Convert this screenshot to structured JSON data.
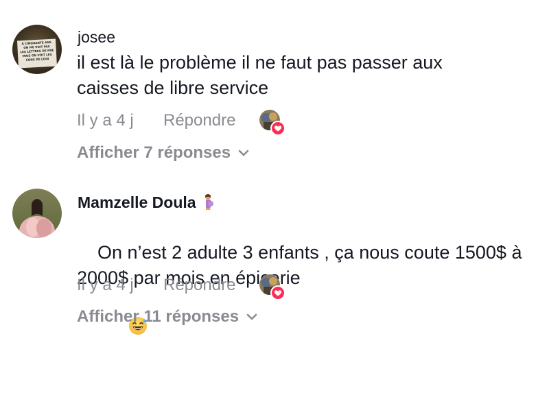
{
  "comments": [
    {
      "username": "josee",
      "avatar_caption": "À CINQUANTE ANS ON ME VOIT PAS LES LETTRES DE PRÈS MAIS ON VOIT LES CONS DE LOIN",
      "text": "il est là le problème il ne faut pas passer aux caisses de libre service",
      "time": "Il y a 4 j",
      "reply_label": "Répondre",
      "view_replies": "Afficher 7 réponses",
      "liked_by_author": true
    },
    {
      "username": "Mamzelle Doula",
      "username_emoji": "pregnant-woman-emoji",
      "text": "On n’est 2 adulte 3 enfants , ça nous coute 1500$ à 2000$ par mois en épicerie",
      "text_emoji": "grinning-sweat-emoji",
      "time": "Il y a 4 j",
      "reply_label": "Répondre",
      "view_replies": "Afficher 11 réponses",
      "liked_by_author": true
    }
  ],
  "colors": {
    "text": "#161823",
    "muted": "#8a8b91",
    "like_red": "#fe2c55"
  }
}
